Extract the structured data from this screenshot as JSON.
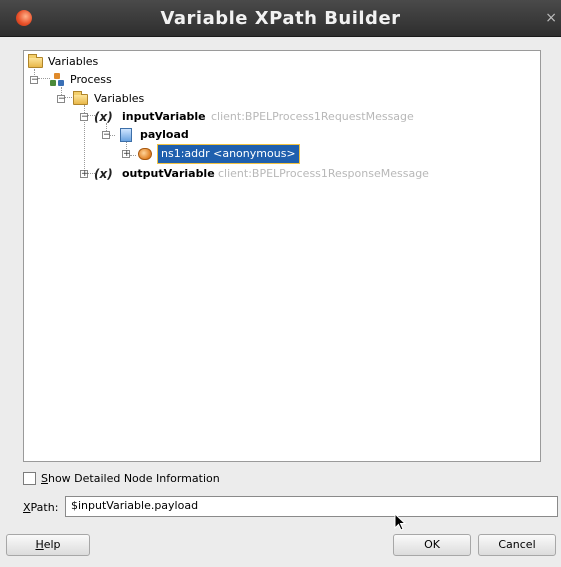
{
  "window": {
    "title": "Variable XPath Builder",
    "close_glyph": "×"
  },
  "tree": {
    "root_label": "Variables",
    "process_label": "Process",
    "variables_label": "Variables",
    "var_glyph": "(x)",
    "input_variable": {
      "name": "inputVariable",
      "type": "client:BPELProcess1RequestMessage"
    },
    "payload_label": "payload",
    "selected_node": "ns1:addr <anonymous>",
    "output_variable": {
      "name": "outputVariable",
      "type": "client:BPELProcess1ResponseMessage"
    }
  },
  "options": {
    "show_detailed_first": "S",
    "show_detailed_rest": "how Detailed Node Information",
    "checked": false
  },
  "xpath": {
    "label_first": "X",
    "label_rest": "Path:",
    "value": "$inputVariable.payload"
  },
  "buttons": {
    "help_first": "H",
    "help_rest": "elp",
    "ok": "OK",
    "cancel": "Cancel"
  },
  "colors": {
    "selection": "#1f5fae",
    "selection_border": "#f2c240",
    "type_text": "#b8b8b8",
    "titlebar": "#3a3a3a"
  }
}
